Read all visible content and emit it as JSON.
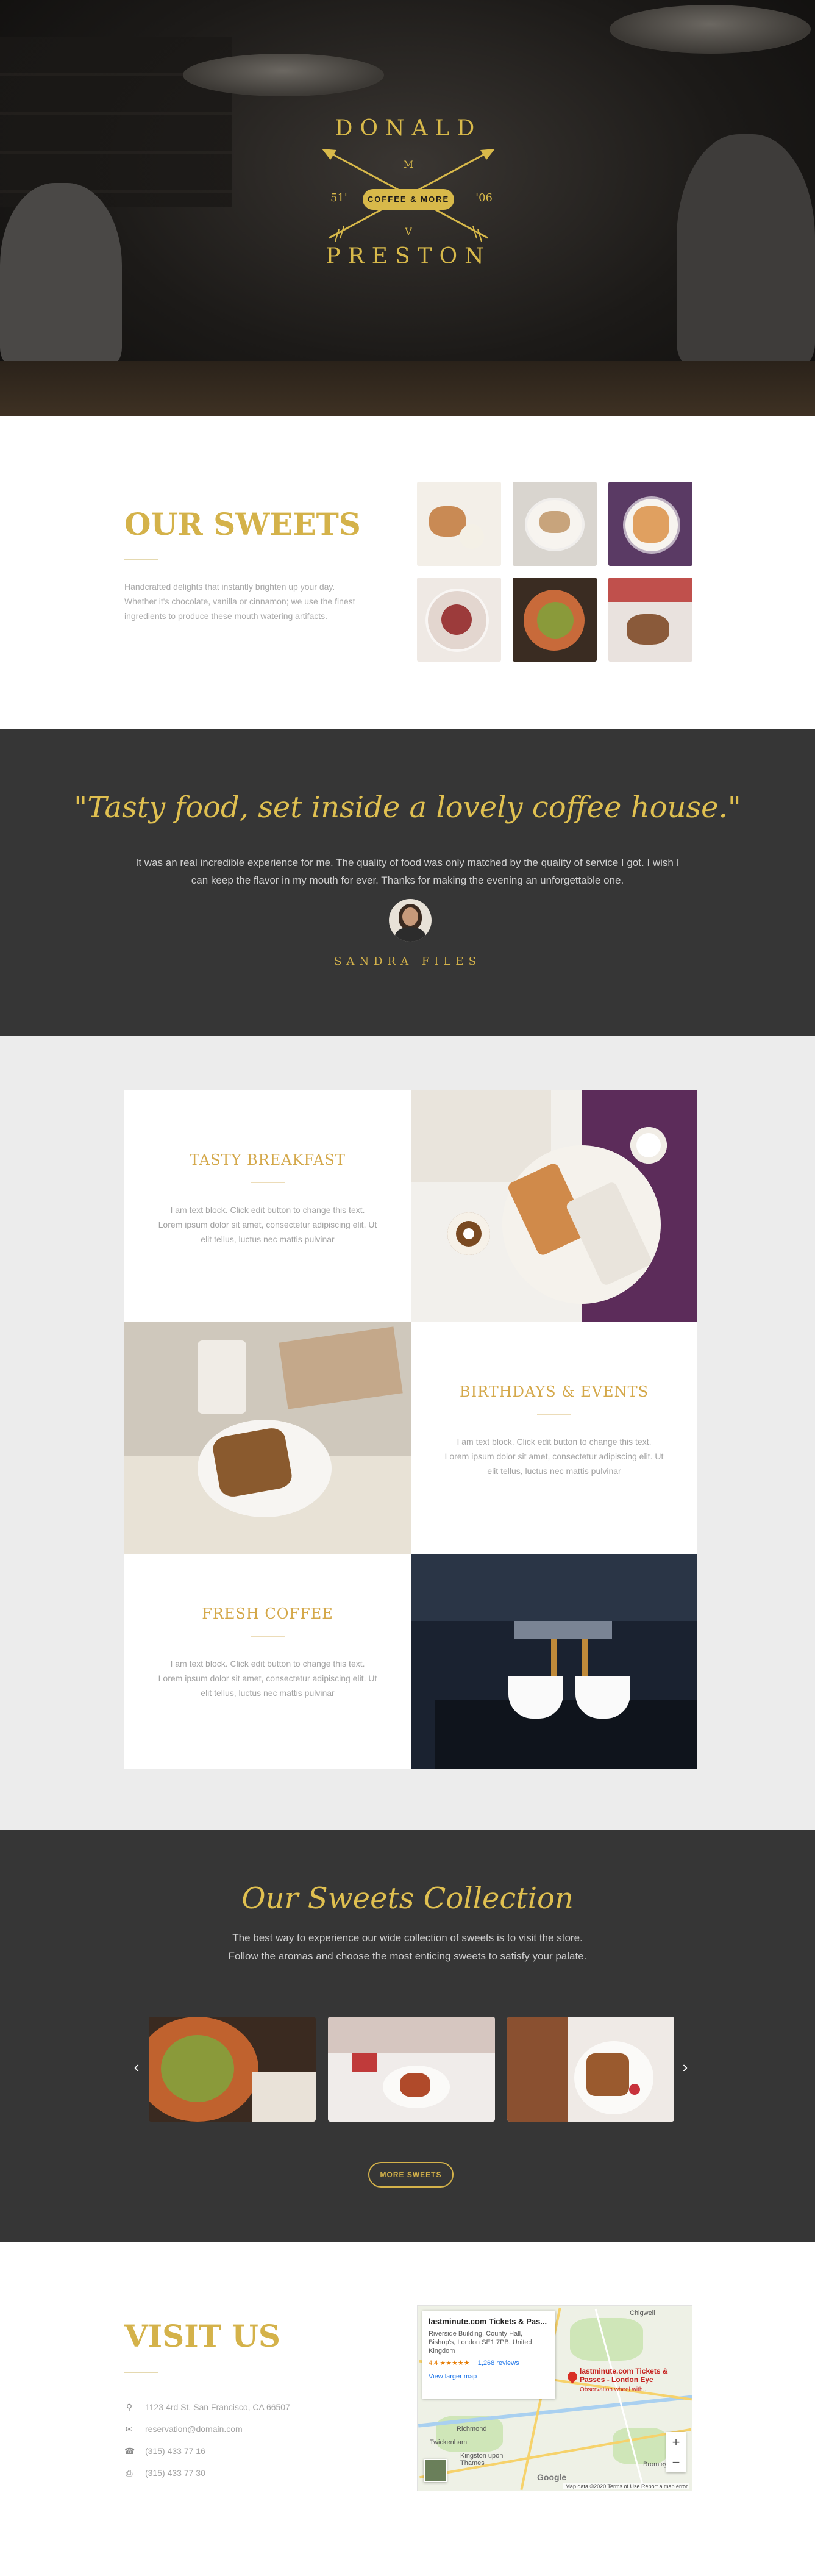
{
  "hero": {
    "logo_top": "DONALD",
    "logo_bottom": "PRESTON",
    "logo_m": "M",
    "logo_v": "V",
    "logo_banner": "COFFEE & MORE",
    "logo_year_left": "51'",
    "logo_year_right": "'06"
  },
  "sweets": {
    "title": "OUR SWEETS",
    "description": "Handcrafted delights that instantly brighten up your day. Whether it's chocolate, vanilla or cinnamon; we use the finest ingredients to produce these mouth watering artifacts."
  },
  "testimonial": {
    "quote": "\"Tasty food, set inside a lovely coffee house.\"",
    "text": "It was an real incredible experience for me. The quality of food was only matched by the quality of service I got. I wish I can keep the flavor in my mouth for ever. Thanks for making the evening an unforgettable one.",
    "name": "SANDRA FILES"
  },
  "services": [
    {
      "title": "TASTY BREAKFAST",
      "text": "I am text block. Click edit button to change this text. Lorem ipsum dolor sit amet, consectetur adipiscing elit. Ut elit tellus, luctus nec mattis pulvinar"
    },
    {
      "title": "BIRTHDAYS & EVENTS",
      "text": "I am text block. Click edit button to change this text. Lorem ipsum dolor sit amet, consectetur adipiscing elit. Ut elit tellus, luctus nec mattis pulvinar"
    },
    {
      "title": "FRESH COFFEE",
      "text": "I am text block. Click edit button to change this text. Lorem ipsum dolor sit amet, consectetur adipiscing elit. Ut elit tellus, luctus nec mattis pulvinar"
    }
  ],
  "collection": {
    "title": "Our Sweets Collection",
    "subtitle_line1": "The best way to experience our wide collection of sweets is to visit the store.",
    "subtitle_line2": "Follow the aromas and choose the most enticing sweets to satisfy your palate.",
    "prev": "‹",
    "next": "›",
    "button": "MORE SWEETS"
  },
  "visit": {
    "title": "VISIT US",
    "address": "1123 4rd St. San Francisco, CA 66507",
    "email": "reservation@domain.com",
    "phone": "(315) 433 77 16",
    "fax": "(315) 433 77 30"
  },
  "map": {
    "place_title": "lastminute.com Tickets & Pas...",
    "place_address": "Riverside Building, County Hall, Bishop's, London SE1 7PB, United Kingdom",
    "rating": "4.4 ★★★★★",
    "reviews": "1,268 reviews",
    "larger_map": "View larger map",
    "pin_label": "lastminute.com Tickets & Passes - London Eye",
    "pin_sub": "Observation wheel with...",
    "label_1": "Chigwell",
    "label_2": "Richmond",
    "label_3": "Twickenham",
    "label_4": "Kingston upon Thames",
    "label_5": "Bromley",
    "zoom_in": "+",
    "zoom_out": "−",
    "brand": "Google",
    "attribution": "Map data ©2020   Terms of Use   Report a map error"
  }
}
